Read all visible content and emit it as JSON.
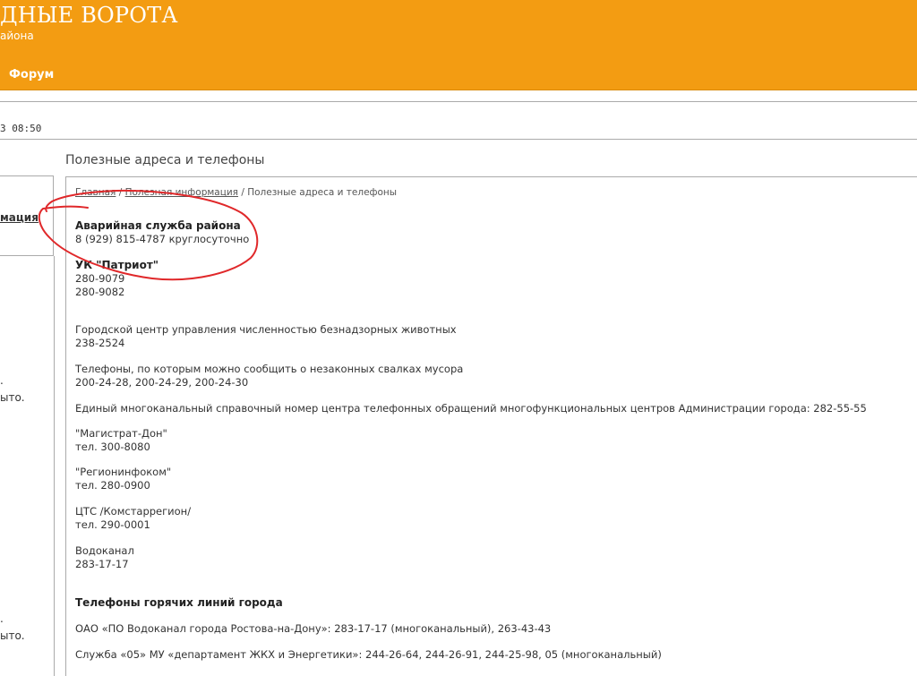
{
  "header": {
    "site_title": "ДНЫЕ ВОРОТА",
    "site_subtitle": "айона",
    "nav_forum": "Форум"
  },
  "datetime": "3 08:50",
  "sidebar": {
    "active_link": "мация",
    "text_1": "ыто.",
    "text_2": "ыто.",
    "dot_1": ".",
    "dot_2": "."
  },
  "section": {
    "title": "Полезные адреса и телефоны"
  },
  "breadcrumb": {
    "home": "Главная",
    "sep1": " / ",
    "useful": "Полезная информация",
    "sep2": " / ",
    "current": "Полезные адреса и телефоны"
  },
  "contacts": {
    "emergency_title": "Аварийная служба района",
    "emergency_phone": "8 (929) 815-4787  круглосуточно",
    "uk_title": "УК \"Патриот\"",
    "uk_phone_1": "280-9079",
    "uk_phone_2": "280-9082",
    "animals_title": "Городской центр управления численностью безнадзорных животных",
    "animals_phone": "238-2524",
    "dumps_title": "Телефоны, по которым можно сообщить о незаконных свалках мусора",
    "dumps_phones": "200-24-28, 200-24-29, 200-24-30",
    "mfc_line": "Единый многоканальный справочный номер центра телефонных обращений многофункциональных центров Администрации города: 282-55-55",
    "magistrat_title": "\"Магистрат-Дон\"",
    "magistrat_phone": "тел. 300-8080",
    "regioninfo_title": "\"Регионинфоком\"",
    "regioninfo_phone": "тел. 280-0900",
    "cts_title": "ЦТС /Комстаррегион/",
    "cts_phone": "тел. 290-0001",
    "vodokanal_title": "Водоканал",
    "vodokanal_phone": "283-17-17",
    "hotlines_title": "Телефоны горячих линий города",
    "hotline_1": "ОАО «ПО Водоканал города Ростова-на-Дону»: 283-17-17 (многоканальный), 263-43-43",
    "hotline_2": "Служба «05» МУ «департамент ЖКХ и Энергетики»: 244-26-64, 244-26-91, 244-25-98, 05 (многоканальный)"
  },
  "colors": {
    "header_bg": "#f39c12",
    "annotation": "#e0282a"
  }
}
